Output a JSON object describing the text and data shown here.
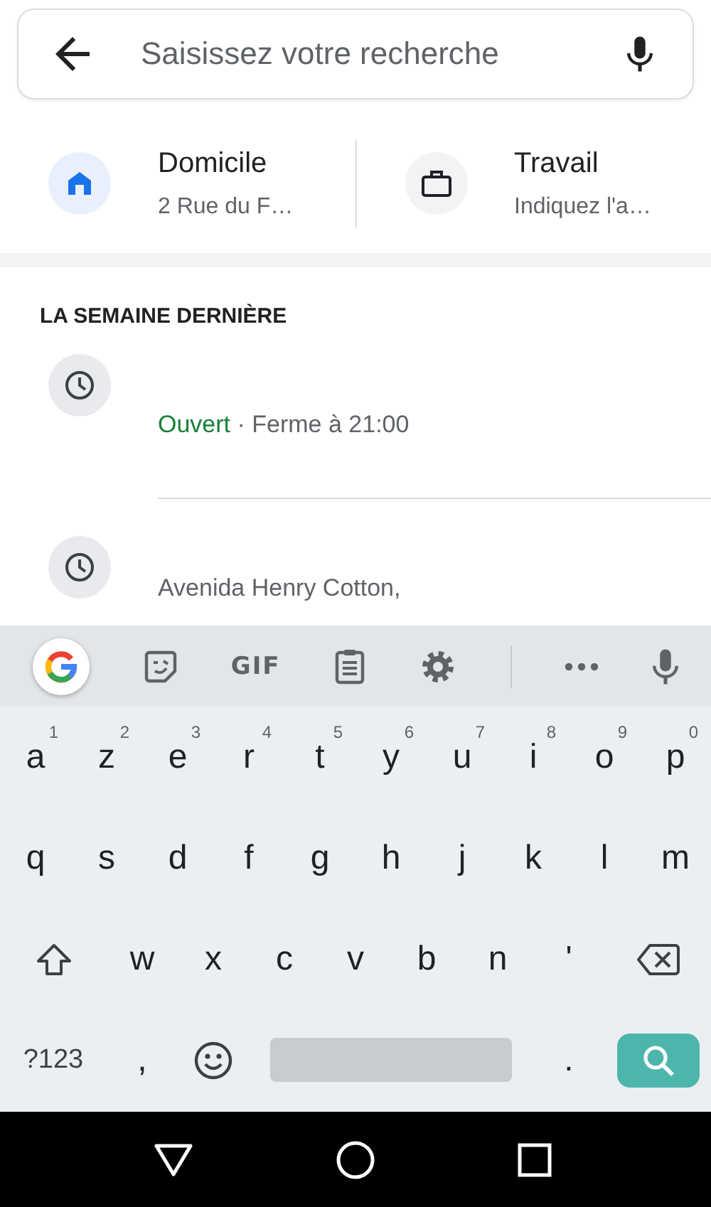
{
  "search": {
    "placeholder": "Saisissez votre recherche"
  },
  "shortcuts": [
    {
      "kind": "home",
      "title": "Domicile",
      "subtitle": "2 Rue du F…"
    },
    {
      "kind": "work",
      "title": "Travail",
      "subtitle": "Indiquez l'a…"
    }
  ],
  "recent": {
    "heading": "LA SEMAINE DERNIÈRE",
    "items": [
      {
        "status": "Ouvert",
        "hours": "· Ferme à 21:00"
      },
      {
        "address": "Avenida Henry Cotton,"
      }
    ]
  },
  "keyboard": {
    "toolbar": [
      {
        "kind": "google"
      },
      {
        "kind": "sticker"
      },
      {
        "kind": "gif",
        "label": "GIF"
      },
      {
        "kind": "clipboard"
      },
      {
        "kind": "settings"
      },
      {
        "kind": "divider"
      },
      {
        "kind": "more"
      },
      {
        "kind": "mic"
      }
    ],
    "rows": [
      [
        {
          "kind": "letter",
          "label": "a",
          "hint": "1"
        },
        {
          "kind": "letter",
          "label": "z",
          "hint": "2"
        },
        {
          "kind": "letter",
          "label": "e",
          "hint": "3"
        },
        {
          "kind": "letter",
          "label": "r",
          "hint": "4"
        },
        {
          "kind": "letter",
          "label": "t",
          "hint": "5"
        },
        {
          "kind": "letter",
          "label": "y",
          "hint": "6"
        },
        {
          "kind": "letter",
          "label": "u",
          "hint": "7"
        },
        {
          "kind": "letter",
          "label": "i",
          "hint": "8"
        },
        {
          "kind": "letter",
          "label": "o",
          "hint": "9"
        },
        {
          "kind": "letter",
          "label": "p",
          "hint": "0"
        }
      ],
      [
        {
          "kind": "letter",
          "label": "q"
        },
        {
          "kind": "letter",
          "label": "s"
        },
        {
          "kind": "letter",
          "label": "d"
        },
        {
          "kind": "letter",
          "label": "f"
        },
        {
          "kind": "letter",
          "label": "g"
        },
        {
          "kind": "letter",
          "label": "h"
        },
        {
          "kind": "letter",
          "label": "j"
        },
        {
          "kind": "letter",
          "label": "k"
        },
        {
          "kind": "letter",
          "label": "l"
        },
        {
          "kind": "letter",
          "label": "m"
        }
      ],
      [
        {
          "kind": "shift"
        },
        {
          "kind": "letter",
          "label": "w"
        },
        {
          "kind": "letter",
          "label": "x"
        },
        {
          "kind": "letter",
          "label": "c"
        },
        {
          "kind": "letter",
          "label": "v"
        },
        {
          "kind": "letter",
          "label": "b"
        },
        {
          "kind": "letter",
          "label": "n"
        },
        {
          "kind": "letter",
          "label": "'"
        },
        {
          "kind": "backspace"
        }
      ],
      [
        {
          "kind": "symbols",
          "label": "?123"
        },
        {
          "kind": "letter",
          "label": ","
        },
        {
          "kind": "emoji"
        },
        {
          "kind": "space"
        },
        {
          "kind": "letter",
          "label": "."
        },
        {
          "kind": "search"
        }
      ]
    ]
  }
}
